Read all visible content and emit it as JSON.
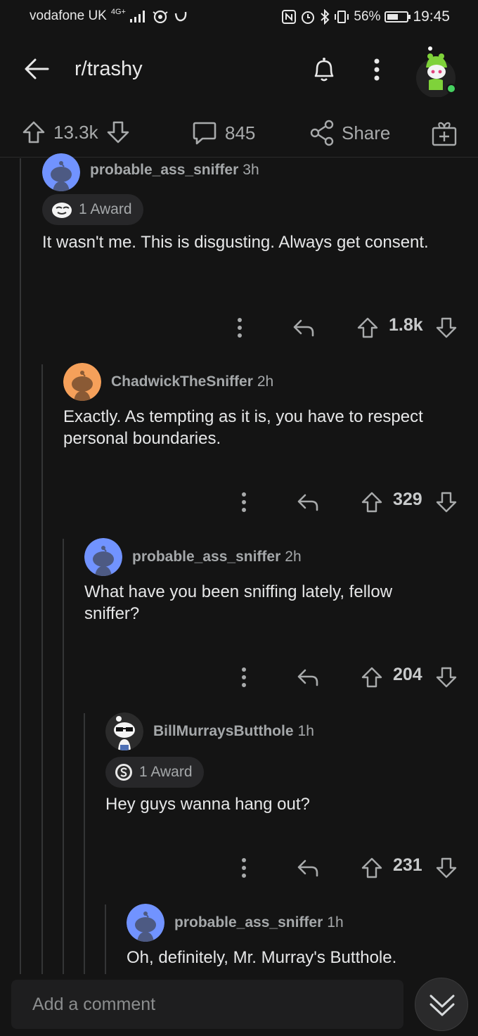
{
  "status_bar": {
    "carrier": "vodafone UK",
    "network": "4G+",
    "battery": "56%",
    "time": "19:45"
  },
  "header": {
    "title": "r/trashy"
  },
  "post_actions": {
    "score": "13.3k",
    "comments": "845",
    "share_label": "Share"
  },
  "comments": [
    {
      "username": "probable_ass_sniffer",
      "age": "3h",
      "award": "1 Award",
      "body": "It wasn't me. This is disgusting. Always get consent.",
      "score": "1.8k",
      "avatar_color": "#7193ff"
    },
    {
      "username": "ChadwickTheSniffer",
      "age": "2h",
      "body": "Exactly. As tempting as it is, you have to respect personal boundaries.",
      "score": "329",
      "avatar_color": "#f5a05a"
    },
    {
      "username": "probable_ass_sniffer",
      "age": "2h",
      "body": "What have you been sniffing lately, fellow sniffer?",
      "score": "204",
      "avatar_color": "#7193ff"
    },
    {
      "username": "BillMurraysButthole",
      "age": "1h",
      "award": "1 Award",
      "body": "Hey guys wanna hang out?",
      "score": "231",
      "avatar_color": "#2b2b2b"
    },
    {
      "username": "probable_ass_sniffer",
      "age": "1h",
      "body": "Oh, definitely, Mr. Murray's Butthole.",
      "avatar_color": "#7193ff"
    }
  ],
  "composer": {
    "placeholder": "Add a comment"
  },
  "colors": {
    "background": "#141414",
    "online_dot": "#46d160",
    "avatar_green": "#7fd23a"
  }
}
